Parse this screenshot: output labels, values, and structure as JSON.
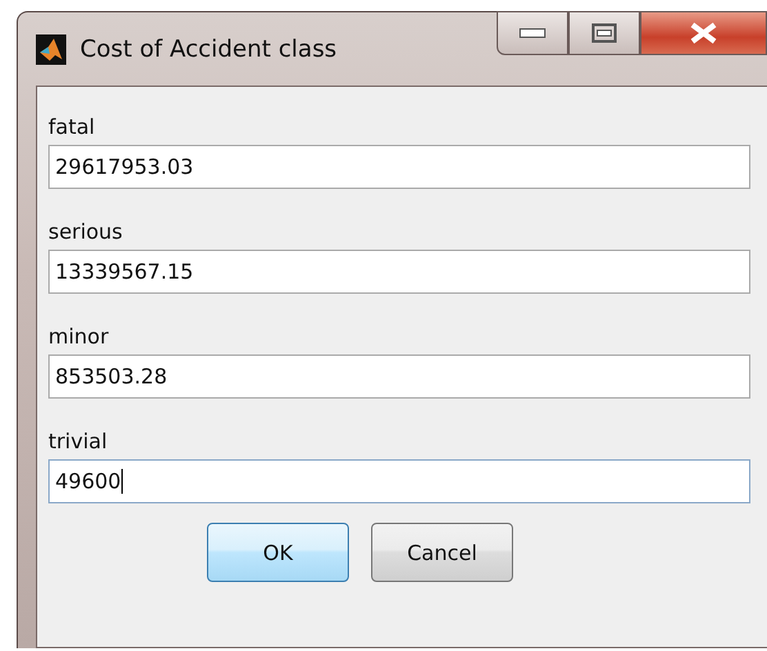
{
  "window": {
    "title": "Cost of Accident class"
  },
  "fields": [
    {
      "label": "fatal",
      "value": "29617953.03",
      "focused": false
    },
    {
      "label": "serious",
      "value": "13339567.15",
      "focused": false
    },
    {
      "label": "minor",
      "value": "853503.28",
      "focused": false
    },
    {
      "label": "trivial",
      "value": "49600",
      "focused": true
    }
  ],
  "buttons": [
    {
      "label": "OK",
      "default": true
    },
    {
      "label": "Cancel",
      "default": false
    }
  ]
}
